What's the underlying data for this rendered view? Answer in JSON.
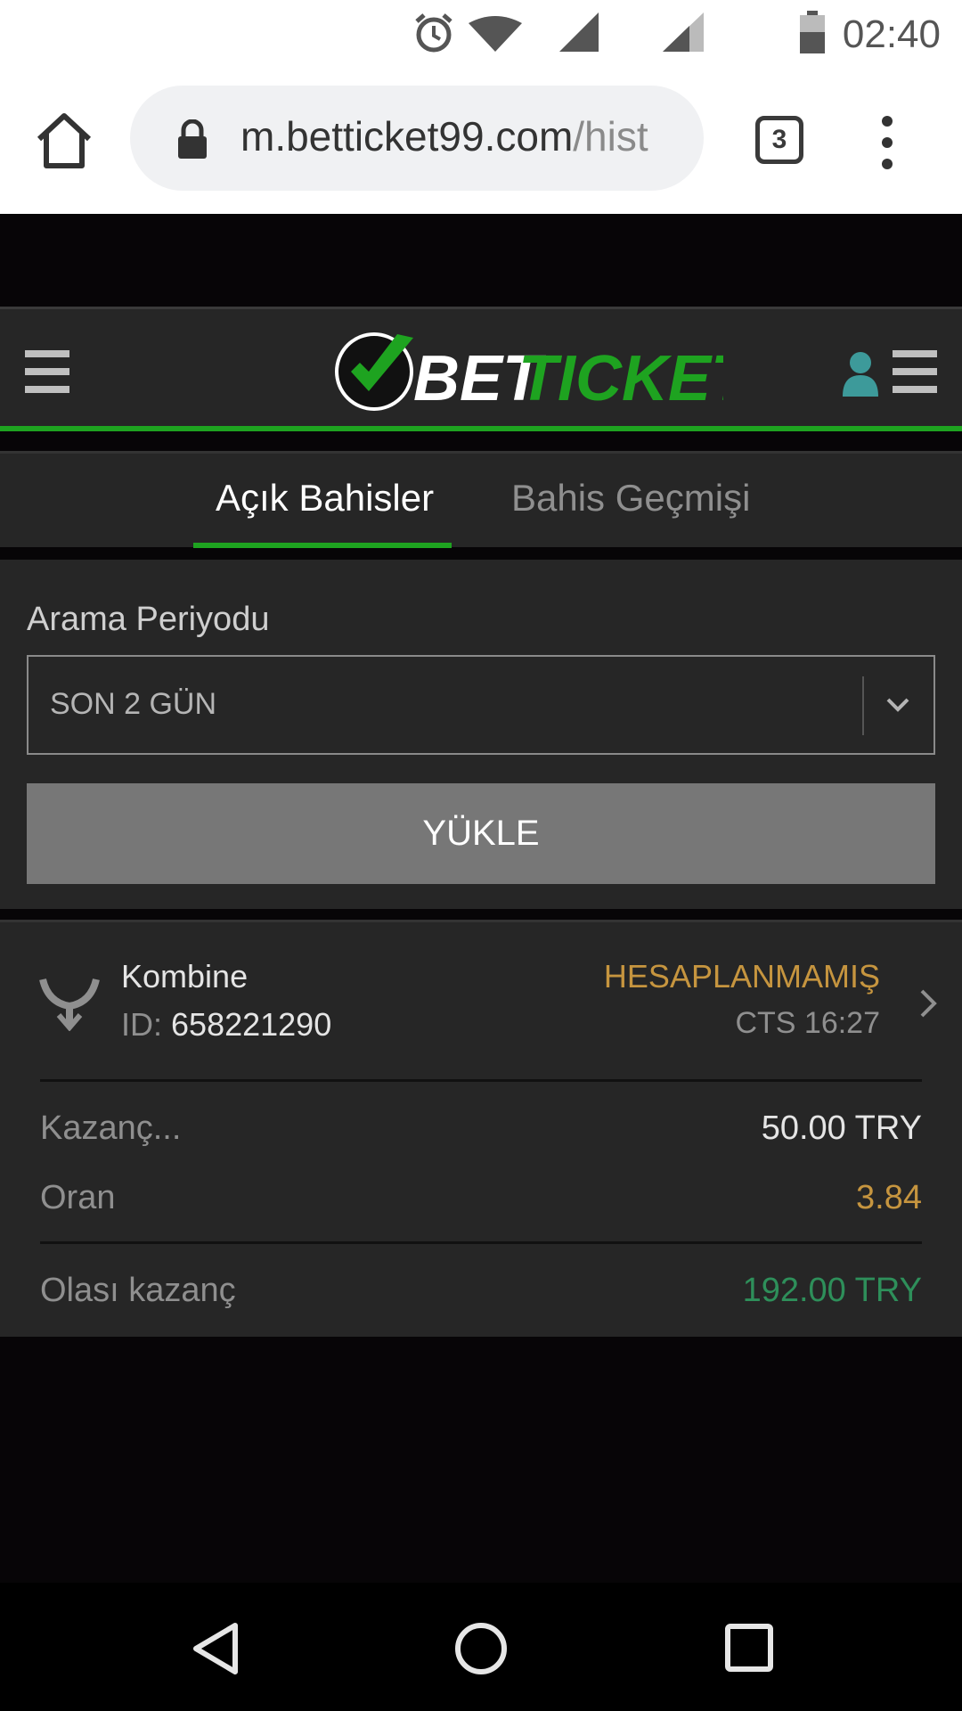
{
  "status_bar": {
    "time": "02:40"
  },
  "browser": {
    "url_main": "m.betticket99.com",
    "url_rest": "/hist",
    "tab_count": "3"
  },
  "header": {
    "logo_text_white": "BET",
    "logo_text_green": "TICKET"
  },
  "tabs": [
    {
      "label": "Açık Bahisler",
      "active": true
    },
    {
      "label": "Bahis Geçmişi",
      "active": false
    }
  ],
  "filter": {
    "label": "Arama Periyodu",
    "selected": "SON 2 GÜN",
    "button": "YÜKLE"
  },
  "bet": {
    "type": "Kombine",
    "id_label": "ID:",
    "id": "658221290",
    "status": "HESAPLANMAMIŞ",
    "time": "CTS 16:27",
    "stake_label": "Kazanç...",
    "stake": "50.00 TRY",
    "odds_label": "Oran",
    "odds": "3.84",
    "payout_label": "Olası kazanç",
    "payout": "192.00 TRY"
  },
  "colors": {
    "accent_green": "#1ea320",
    "status_orange": "#c6953f",
    "payout_green": "#2e8f5a",
    "user_teal": "#3d9a9a"
  }
}
